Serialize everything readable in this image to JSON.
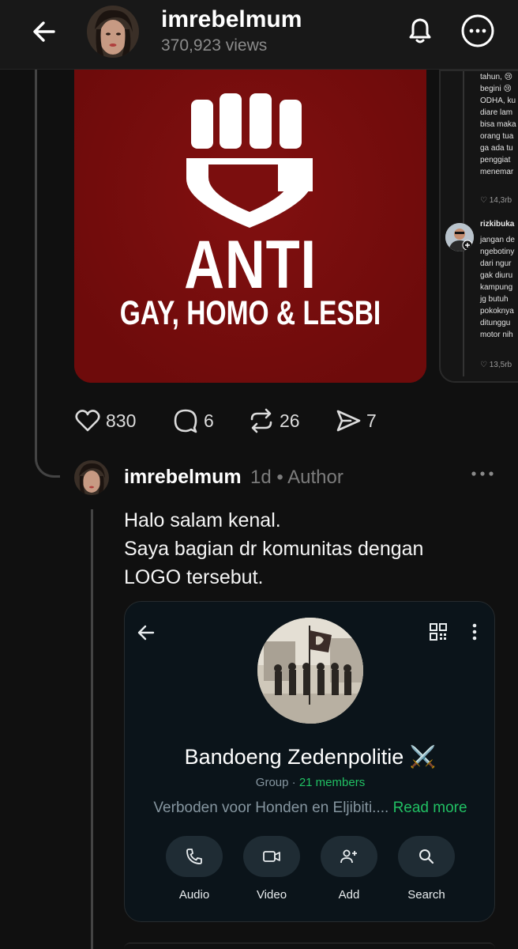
{
  "header": {
    "username": "imrebelmum",
    "views": "370,923 views",
    "icons": [
      "back-arrow-icon",
      "bell-icon",
      "more-options-icon"
    ]
  },
  "media": {
    "anti_text": "ANTI",
    "sub_text": "GAY, HOMO & LESBI",
    "background_color": "#7b0e0e"
  },
  "side_comment": {
    "lines": "tahun, 😢\nbegini 😢\nODHA, ku\ndiare lam\nbisa maka\norang tua\nga ada tu\npenggiat\nmenemar",
    "likes_1": "14,3rb",
    "commenter": "rizkibuka",
    "lines_2": "jangan de\nngebotiny\ndari ngur\ngak diuru\nkampung\njg butuh \npokoknya\nditunggu\nmotor nih",
    "likes_2": "13,5rb"
  },
  "actions": {
    "likes": "830",
    "comments": "6",
    "reposts": "26",
    "shares": "7"
  },
  "reply": {
    "username": "imrebelmum",
    "meta": "1d • Author",
    "line1": "Halo salam kenal.",
    "line2": "Saya bagian dr komunitas dengan",
    "line3": "LOGO tersebut."
  },
  "group_card": {
    "title": "Bandoeng Zedenpolitie ⚔️",
    "type": "Group · ",
    "members": "21 members",
    "description": "Verboden voor Honden en Eljibiti.... ",
    "read_more": "Read more",
    "buttons": [
      {
        "label": "Audio",
        "icon": "phone-icon"
      },
      {
        "label": "Video",
        "icon": "video-icon"
      },
      {
        "label": "Add",
        "icon": "add-person-icon"
      },
      {
        "label": "Search",
        "icon": "search-icon"
      }
    ],
    "accent_color": "#21c063"
  }
}
